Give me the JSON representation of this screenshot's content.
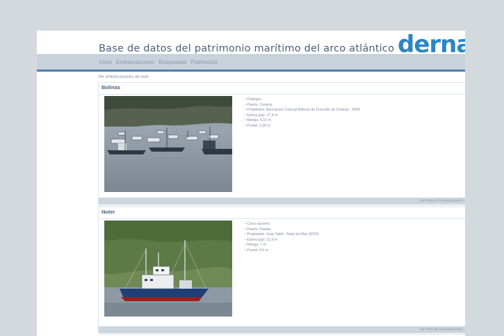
{
  "header": {
    "title": "Base de datos del patrimonio marítimo del arco atlántico",
    "logo_text": "derna",
    "nav": [
      "Inicio",
      "Embarcaciones",
      "Búsquedas",
      "Patrimonio"
    ]
  },
  "breadcrumb": "Ver embarcaciones de este",
  "vessels": [
    {
      "name": "Bolinas",
      "specs": [
        "Palangre",
        "Puerto: Cedeira",
        "Propietario: Asociación Cultural Bolinas do Concello de Cedeira - 2006",
        "Eslora (pp): 17,9 m",
        "Manga: 5,10 m",
        "Puntal: 2,35 m"
      ],
      "footer": "Ver ficha de la embarcación"
    },
    {
      "name": "Nuter",
      "specs": [
        "Cerco atunero",
        "Puerto: Pasaia",
        "Propietario: Itsas Talde - Avila del Mar (2002)",
        "Eslora (pp): 21,6 m",
        "Manga: 7 m",
        "Puntal: 4,5 m"
      ],
      "footer": "Ver ficha de la embarcación"
    }
  ],
  "colors": {
    "logo": "#2a86c6",
    "title": "#4a5f76",
    "nav_rule": "#4d7fb0",
    "background": "#d4d9de"
  }
}
